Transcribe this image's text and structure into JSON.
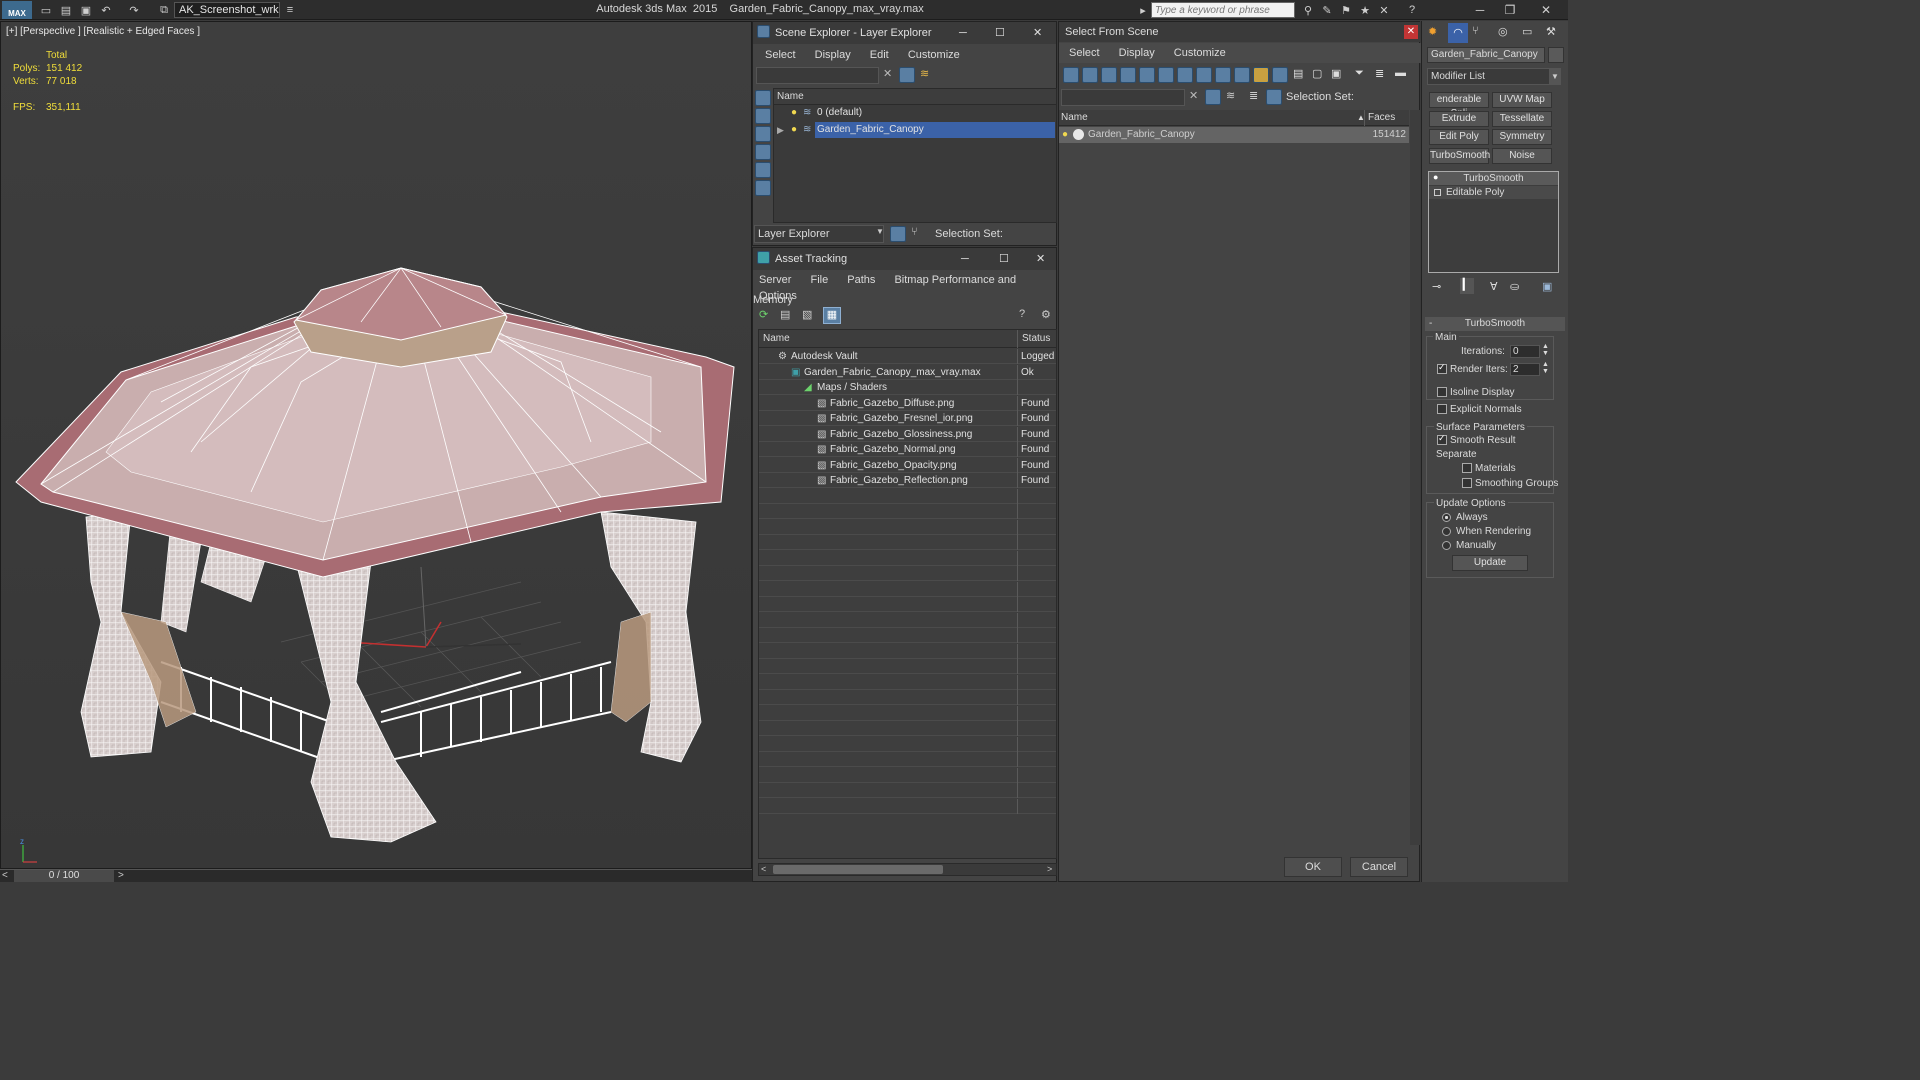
{
  "titlebar": {
    "logo": "MAX",
    "workspace": "AK_Screenshot_wrksp",
    "app_title": "Autodesk 3ds Max  2015    Garden_Fabric_Canopy_max_vray.max",
    "search_placeholder": "Type a keyword or phrase"
  },
  "viewport": {
    "label": "[+] [Perspective ] [Realistic + Edged Faces ]",
    "stats": {
      "total_label": "Total",
      "polys_label": "Polys:",
      "polys": "151 412",
      "verts_label": "Verts:",
      "verts": "77 018",
      "fps_label": "FPS:",
      "fps": "351,111"
    },
    "timeline": "0 / 100"
  },
  "scene_explorer": {
    "title": "Scene Explorer - Layer Explorer",
    "menu": [
      "Select",
      "Display",
      "Edit",
      "Customize"
    ],
    "column_name": "Name",
    "layers": [
      {
        "name": "0 (default)",
        "selected": false
      },
      {
        "name": "Garden_Fabric_Canopy",
        "selected": true
      }
    ],
    "footer_dropdown": "Layer Explorer",
    "selection_set_label": "Selection Set:"
  },
  "asset_tracking": {
    "title": "Asset Tracking",
    "menu": [
      "Server",
      "File",
      "Paths",
      "Bitmap Performance and Memory",
      "Options"
    ],
    "columns": {
      "name": "Name",
      "status": "Status"
    },
    "rows": [
      {
        "name": "Autodesk Vault",
        "status": "Logged",
        "level": 1
      },
      {
        "name": "Garden_Fabric_Canopy_max_vray.max",
        "status": "Ok",
        "level": 2
      },
      {
        "name": "Maps / Shaders",
        "status": "",
        "level": 3
      },
      {
        "name": "Fabric_Gazebo_Diffuse.png",
        "status": "Found",
        "level": 4
      },
      {
        "name": "Fabric_Gazebo_Fresnel_ior.png",
        "status": "Found",
        "level": 4
      },
      {
        "name": "Fabric_Gazebo_Glossiness.png",
        "status": "Found",
        "level": 4
      },
      {
        "name": "Fabric_Gazebo_Normal.png",
        "status": "Found",
        "level": 4
      },
      {
        "name": "Fabric_Gazebo_Opacity.png",
        "status": "Found",
        "level": 4
      },
      {
        "name": "Fabric_Gazebo_Reflection.png",
        "status": "Found",
        "level": 4
      }
    ]
  },
  "select_from_scene": {
    "title": "Select From Scene",
    "menu": [
      "Select",
      "Display",
      "Customize"
    ],
    "selection_set_label": "Selection Set:",
    "columns": {
      "name": "Name",
      "faces": "Faces"
    },
    "rows": [
      {
        "name": "Garden_Fabric_Canopy",
        "faces": "151412"
      }
    ],
    "ok_label": "OK",
    "cancel_label": "Cancel"
  },
  "command_panel": {
    "object_name": "Garden_Fabric_Canopy",
    "modifier_list": "Modifier List",
    "modifier_buttons": [
      "enderable Spli",
      "UVW Map",
      "Extrude",
      "Tessellate",
      "Edit Poly",
      "Symmetry",
      "TurboSmooth",
      "Noise"
    ],
    "stack": [
      "TurboSmooth",
      "Editable Poly"
    ],
    "rollout_title": "TurboSmooth",
    "main_label": "Main",
    "iterations_label": "Iterations:",
    "iterations_value": "0",
    "render_iters_label": "Render Iters:",
    "render_iters_value": "2",
    "isoline_label": "Isoline Display",
    "explicit_normals_label": "Explicit Normals",
    "surface_params_label": "Surface Parameters",
    "smooth_result_label": "Smooth Result",
    "separate_label": "Separate",
    "materials_label": "Materials",
    "smoothing_groups_label": "Smoothing Groups",
    "update_options_label": "Update Options",
    "always_label": "Always",
    "when_rendering_label": "When Rendering",
    "manually_label": "Manually",
    "update_button": "Update"
  },
  "colors": {
    "selection_blue": "#3b62a8",
    "stat_yellow": "#f1de3a",
    "canopy_fabric": "#b8868a",
    "wireframe": "#ffffff"
  }
}
